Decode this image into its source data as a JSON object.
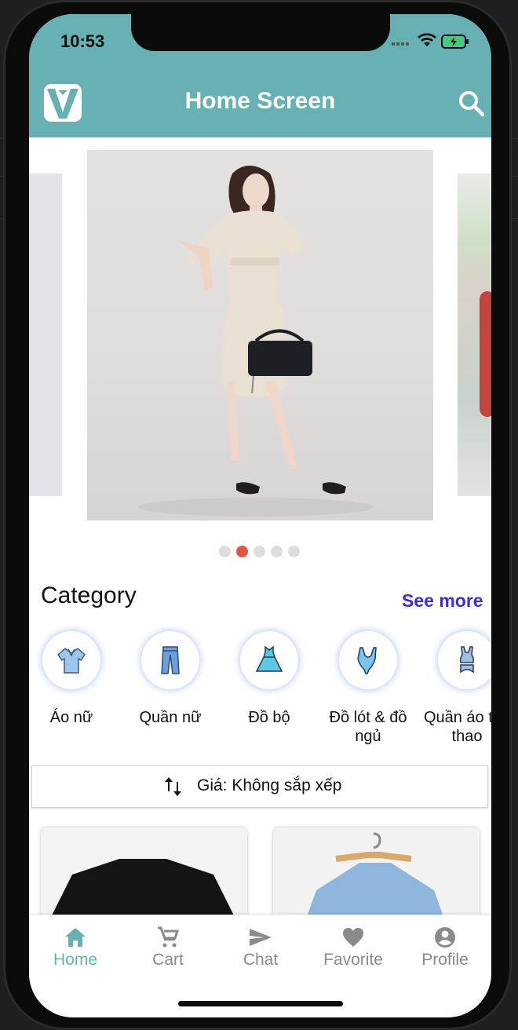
{
  "status_bar": {
    "time": "10:53"
  },
  "app_bar": {
    "title": "Home Screen",
    "logo_icon": "v-shirt-logo",
    "search_icon": "search-icon"
  },
  "carousel": {
    "slide_count": 5,
    "active_index": 1
  },
  "category": {
    "title": "Category",
    "see_more": "See more",
    "items": [
      {
        "label": "Áo nữ",
        "icon": "blouse-icon"
      },
      {
        "label": "Quần nữ",
        "icon": "jeans-icon"
      },
      {
        "label": "Đồ bộ",
        "icon": "dress-icon"
      },
      {
        "label": "Đồ lót & đồ ngủ",
        "icon": "bodysuit-icon"
      },
      {
        "label": "Quần áo thể thao",
        "icon": "sportswear-icon"
      }
    ]
  },
  "sort": {
    "label": "Giá: Không sắp xếp",
    "icon": "sort-arrows-icon"
  },
  "tabs": [
    {
      "label": "Home",
      "icon": "home-icon",
      "active": true
    },
    {
      "label": "Cart",
      "icon": "cart-icon",
      "active": false
    },
    {
      "label": "Chat",
      "icon": "send-icon",
      "active": false
    },
    {
      "label": "Favorite",
      "icon": "heart-icon",
      "active": false
    },
    {
      "label": "Profile",
      "icon": "account-icon",
      "active": false
    }
  ],
  "colors": {
    "primary": "#67b1b5",
    "accent_link": "#3a2fd1",
    "active_dot": "#e25443"
  }
}
